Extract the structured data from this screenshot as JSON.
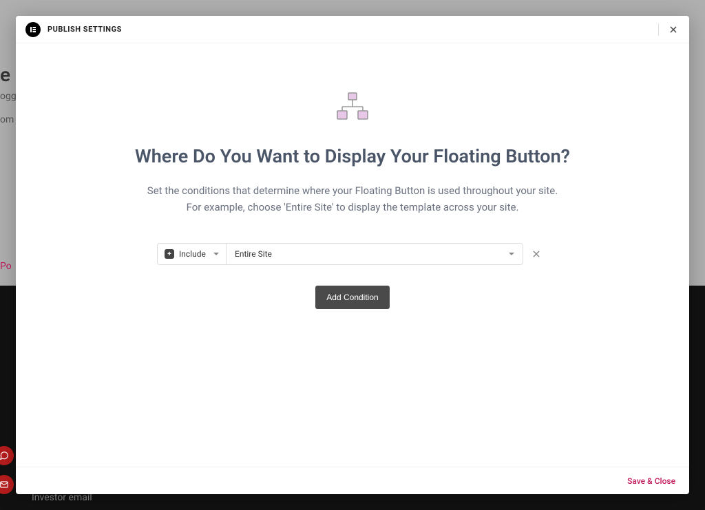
{
  "modal": {
    "title": "PUBLISH SETTINGS",
    "heading": "Where Do You Want to Display Your Floating Button?",
    "subtext": "Set the conditions that determine where your Floating Button is used throughout your site.\nFor example, choose 'Entire Site' to display the template across your site.",
    "condition": {
      "mode": "Include",
      "scope": "Entire Site"
    },
    "add_condition_label": "Add Condition",
    "footer": {
      "save_close": "Save & Close"
    }
  },
  "background": {
    "fragment_e": "e",
    "fragment_ogg": "ogg",
    "fragment_om": "om",
    "fragment_po": "Po",
    "investor_email": "Investor email"
  }
}
